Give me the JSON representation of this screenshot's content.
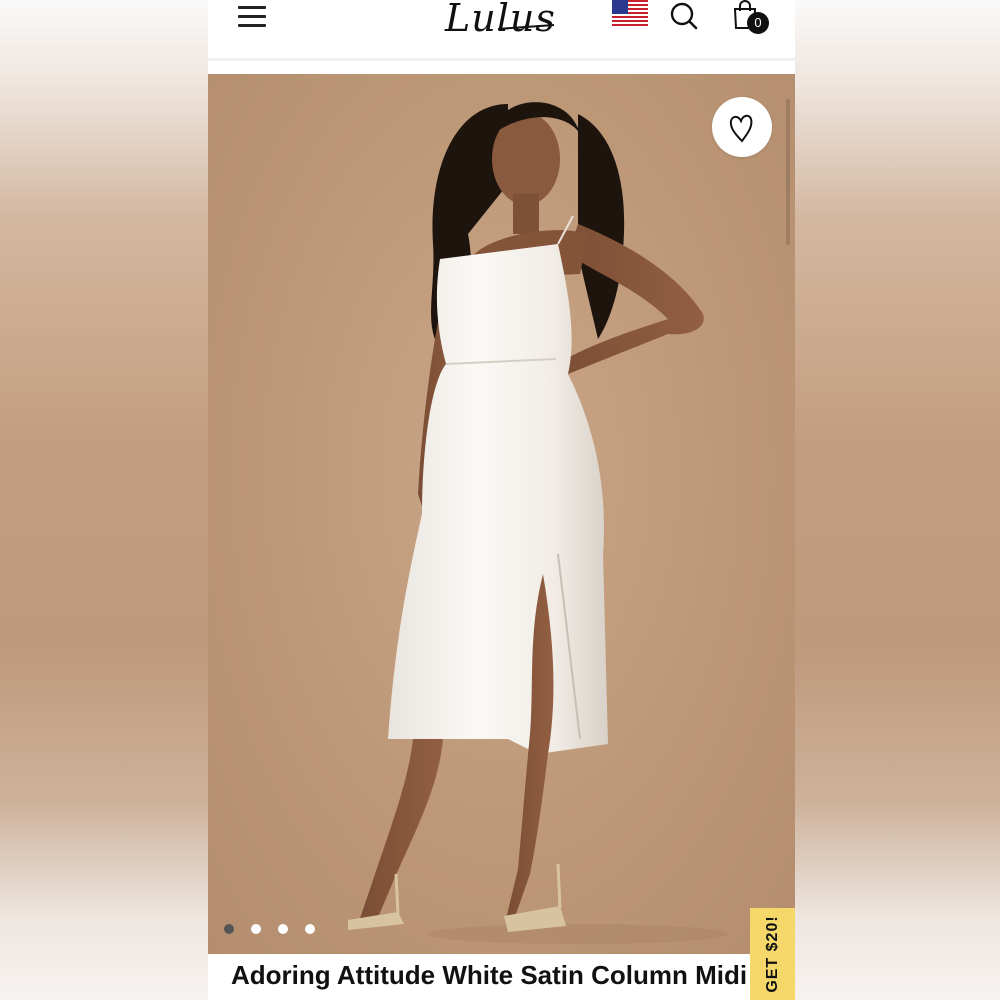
{
  "header": {
    "logo_text": "Lulus",
    "cart_count": "0",
    "icons": [
      "menu-icon",
      "us-flag-icon",
      "search-icon",
      "shopping-bag-icon"
    ]
  },
  "gallery": {
    "image_count": 4,
    "active_index": 0,
    "favorite_icon": "heart-icon"
  },
  "product": {
    "title": "Adoring Attitude White Satin Column Midi Dress"
  },
  "promo": {
    "label": "GET $20!"
  },
  "colors": {
    "background": "#bd9877",
    "promo": "#f6d86a",
    "text": "#111111"
  }
}
